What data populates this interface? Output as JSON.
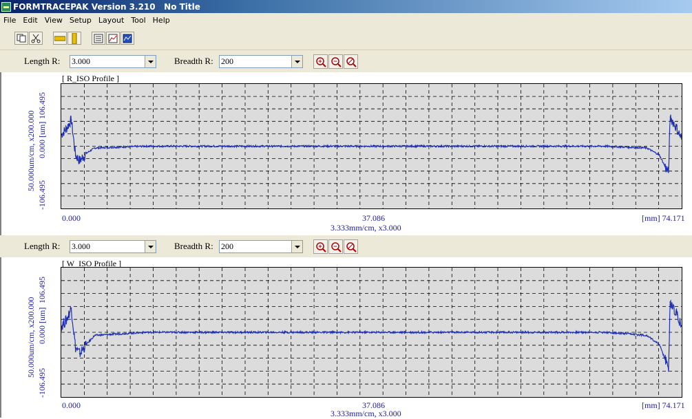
{
  "window": {
    "title": "FORMTRACEPAK Version 3.210   No Title"
  },
  "menu": [
    "File",
    "Edit",
    "View",
    "Setup",
    "Layout",
    "Tool",
    "Help"
  ],
  "controls": {
    "length_label": "Length R:",
    "length_value": "3.000",
    "breadth_label": "Breadth R:",
    "breadth_value": "200"
  },
  "colors": {
    "trace": "#1c2fb5",
    "label": "#1a1aa0",
    "grid": "#000000",
    "plot_bg": "#dcdcdc"
  },
  "charts": [
    {
      "title": "[ R_ISO Profile ]",
      "y_unit": "50.000um/cm, x200.000",
      "y_top": "106.495",
      "y_mid": "0.000 [um]",
      "y_bottom": "-106.495",
      "x_left": "0.000",
      "x_mid": "37.086",
      "x_right": "[mm] 74.171",
      "x_scale": "3.333mm/cm, x3.000"
    },
    {
      "title": "[ W_ISO Profile ]",
      "y_unit": "50.000um/cm, x200.000",
      "y_top": "106.495",
      "y_mid": "0.000 [um]",
      "y_bottom": "-106.495",
      "x_left": "0.000",
      "x_mid": "37.086",
      "x_right": "[mm] 74.171",
      "x_scale": "3.333mm/cm, x3.000"
    }
  ],
  "chart_data": [
    {
      "type": "line",
      "title": "[ R_ISO Profile ]",
      "xlabel": "3.333mm/cm, x3.000",
      "ylabel": "50.000um/cm, x200.000",
      "xlim": [
        0,
        74.171
      ],
      "ylim": [
        -106.495,
        106.495
      ],
      "grid": true,
      "x": [
        0.0,
        0.6,
        1.2,
        1.7,
        2.2,
        3.0,
        4.0,
        10.0,
        37.086,
        65.0,
        70.0,
        71.5,
        72.2,
        72.6,
        72.8,
        73.6,
        74.171
      ],
      "values": [
        20,
        30,
        45,
        -15,
        -25,
        -12,
        -3,
        0,
        0,
        0,
        -3,
        -15,
        -35,
        -45,
        50,
        30,
        12
      ]
    },
    {
      "type": "line",
      "title": "[ W_ISO Profile ]",
      "xlabel": "3.333mm/cm, x3.000",
      "ylabel": "50.000um/cm, x200.000",
      "xlim": [
        0,
        74.171
      ],
      "ylim": [
        -106.495,
        106.495
      ],
      "grid": true,
      "x": [
        0.0,
        0.6,
        1.2,
        1.7,
        2.2,
        3.0,
        4.0,
        10.0,
        37.086,
        65.0,
        70.0,
        71.5,
        72.2,
        72.6,
        72.8,
        73.6,
        74.171
      ],
      "values": [
        10,
        20,
        40,
        -25,
        -35,
        -20,
        -5,
        0,
        0,
        0,
        -5,
        -20,
        -45,
        -60,
        50,
        30,
        10
      ]
    }
  ]
}
